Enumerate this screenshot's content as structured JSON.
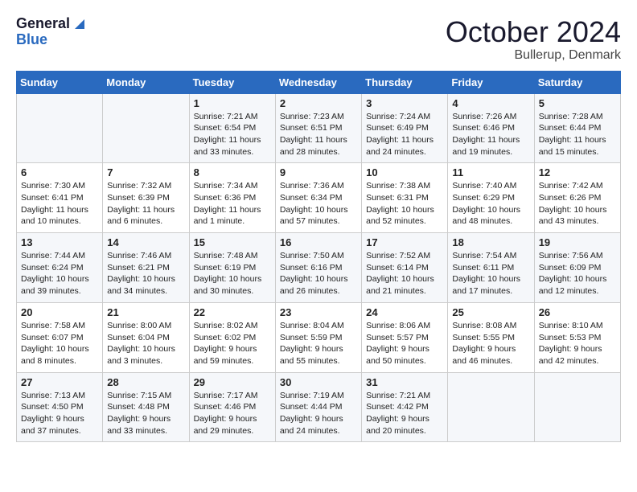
{
  "header": {
    "logo_line1": "General",
    "logo_line2": "Blue",
    "month": "October 2024",
    "location": "Bullerup, Denmark"
  },
  "weekdays": [
    "Sunday",
    "Monday",
    "Tuesday",
    "Wednesday",
    "Thursday",
    "Friday",
    "Saturday"
  ],
  "weeks": [
    [
      {
        "day": "",
        "text": ""
      },
      {
        "day": "",
        "text": ""
      },
      {
        "day": "1",
        "text": "Sunrise: 7:21 AM\nSunset: 6:54 PM\nDaylight: 11 hours\nand 33 minutes."
      },
      {
        "day": "2",
        "text": "Sunrise: 7:23 AM\nSunset: 6:51 PM\nDaylight: 11 hours\nand 28 minutes."
      },
      {
        "day": "3",
        "text": "Sunrise: 7:24 AM\nSunset: 6:49 PM\nDaylight: 11 hours\nand 24 minutes."
      },
      {
        "day": "4",
        "text": "Sunrise: 7:26 AM\nSunset: 6:46 PM\nDaylight: 11 hours\nand 19 minutes."
      },
      {
        "day": "5",
        "text": "Sunrise: 7:28 AM\nSunset: 6:44 PM\nDaylight: 11 hours\nand 15 minutes."
      }
    ],
    [
      {
        "day": "6",
        "text": "Sunrise: 7:30 AM\nSunset: 6:41 PM\nDaylight: 11 hours\nand 10 minutes."
      },
      {
        "day": "7",
        "text": "Sunrise: 7:32 AM\nSunset: 6:39 PM\nDaylight: 11 hours\nand 6 minutes."
      },
      {
        "day": "8",
        "text": "Sunrise: 7:34 AM\nSunset: 6:36 PM\nDaylight: 11 hours\nand 1 minute."
      },
      {
        "day": "9",
        "text": "Sunrise: 7:36 AM\nSunset: 6:34 PM\nDaylight: 10 hours\nand 57 minutes."
      },
      {
        "day": "10",
        "text": "Sunrise: 7:38 AM\nSunset: 6:31 PM\nDaylight: 10 hours\nand 52 minutes."
      },
      {
        "day": "11",
        "text": "Sunrise: 7:40 AM\nSunset: 6:29 PM\nDaylight: 10 hours\nand 48 minutes."
      },
      {
        "day": "12",
        "text": "Sunrise: 7:42 AM\nSunset: 6:26 PM\nDaylight: 10 hours\nand 43 minutes."
      }
    ],
    [
      {
        "day": "13",
        "text": "Sunrise: 7:44 AM\nSunset: 6:24 PM\nDaylight: 10 hours\nand 39 minutes."
      },
      {
        "day": "14",
        "text": "Sunrise: 7:46 AM\nSunset: 6:21 PM\nDaylight: 10 hours\nand 34 minutes."
      },
      {
        "day": "15",
        "text": "Sunrise: 7:48 AM\nSunset: 6:19 PM\nDaylight: 10 hours\nand 30 minutes."
      },
      {
        "day": "16",
        "text": "Sunrise: 7:50 AM\nSunset: 6:16 PM\nDaylight: 10 hours\nand 26 minutes."
      },
      {
        "day": "17",
        "text": "Sunrise: 7:52 AM\nSunset: 6:14 PM\nDaylight: 10 hours\nand 21 minutes."
      },
      {
        "day": "18",
        "text": "Sunrise: 7:54 AM\nSunset: 6:11 PM\nDaylight: 10 hours\nand 17 minutes."
      },
      {
        "day": "19",
        "text": "Sunrise: 7:56 AM\nSunset: 6:09 PM\nDaylight: 10 hours\nand 12 minutes."
      }
    ],
    [
      {
        "day": "20",
        "text": "Sunrise: 7:58 AM\nSunset: 6:07 PM\nDaylight: 10 hours\nand 8 minutes."
      },
      {
        "day": "21",
        "text": "Sunrise: 8:00 AM\nSunset: 6:04 PM\nDaylight: 10 hours\nand 3 minutes."
      },
      {
        "day": "22",
        "text": "Sunrise: 8:02 AM\nSunset: 6:02 PM\nDaylight: 9 hours\nand 59 minutes."
      },
      {
        "day": "23",
        "text": "Sunrise: 8:04 AM\nSunset: 5:59 PM\nDaylight: 9 hours\nand 55 minutes."
      },
      {
        "day": "24",
        "text": "Sunrise: 8:06 AM\nSunset: 5:57 PM\nDaylight: 9 hours\nand 50 minutes."
      },
      {
        "day": "25",
        "text": "Sunrise: 8:08 AM\nSunset: 5:55 PM\nDaylight: 9 hours\nand 46 minutes."
      },
      {
        "day": "26",
        "text": "Sunrise: 8:10 AM\nSunset: 5:53 PM\nDaylight: 9 hours\nand 42 minutes."
      }
    ],
    [
      {
        "day": "27",
        "text": "Sunrise: 7:13 AM\nSunset: 4:50 PM\nDaylight: 9 hours\nand 37 minutes."
      },
      {
        "day": "28",
        "text": "Sunrise: 7:15 AM\nSunset: 4:48 PM\nDaylight: 9 hours\nand 33 minutes."
      },
      {
        "day": "29",
        "text": "Sunrise: 7:17 AM\nSunset: 4:46 PM\nDaylight: 9 hours\nand 29 minutes."
      },
      {
        "day": "30",
        "text": "Sunrise: 7:19 AM\nSunset: 4:44 PM\nDaylight: 9 hours\nand 24 minutes."
      },
      {
        "day": "31",
        "text": "Sunrise: 7:21 AM\nSunset: 4:42 PM\nDaylight: 9 hours\nand 20 minutes."
      },
      {
        "day": "",
        "text": ""
      },
      {
        "day": "",
        "text": ""
      }
    ]
  ]
}
